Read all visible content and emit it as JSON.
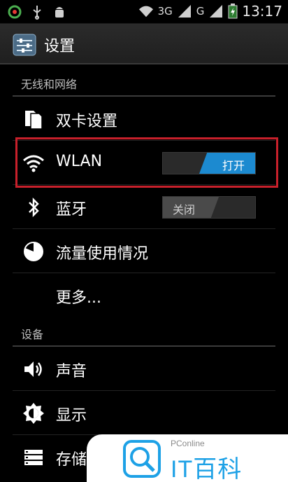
{
  "status_bar": {
    "net_3g": "3G",
    "net_g": "G",
    "time": "13:17"
  },
  "action_bar": {
    "title": "设置"
  },
  "sections": {
    "wireless": "无线和网络",
    "device": "设备"
  },
  "rows": {
    "dual_sim": "双卡设置",
    "wlan": "WLAN",
    "bluetooth": "蓝牙",
    "data_usage": "流量使用情况",
    "more": "更多...",
    "sound": "声音",
    "display": "显示",
    "storage": "存储"
  },
  "toggles": {
    "wlan_state": "打开",
    "bluetooth_state": "关闭"
  },
  "watermark": {
    "small": "PConline",
    "brand": "IT百科"
  },
  "colors": {
    "toggle_on": "#1c8ad0",
    "highlight_border": "#c8202b",
    "brand": "#1da1e6"
  }
}
